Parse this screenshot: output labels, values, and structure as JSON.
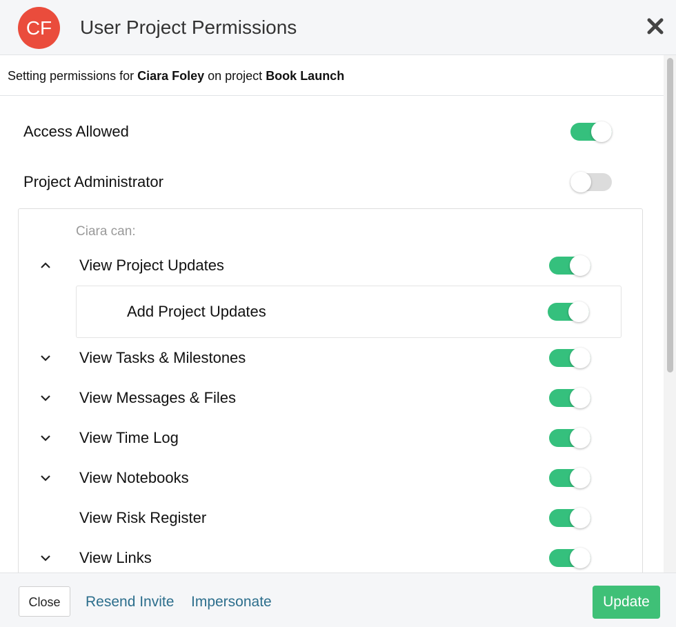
{
  "header": {
    "avatar_initials": "CF",
    "title": "User Project Permissions",
    "close_icon": "close-x-icon"
  },
  "subtitle": {
    "prefix": "Setting permissions for ",
    "user": "Ciara Foley",
    "middle": " on project ",
    "project": "Book Launch"
  },
  "top_permissions": [
    {
      "label": "Access Allowed",
      "enabled": true
    },
    {
      "label": "Project Administrator",
      "enabled": false
    }
  ],
  "permissions_heading": "Ciara can:",
  "permissions": [
    {
      "label": "View Project Updates",
      "enabled": true,
      "chevron": "up"
    },
    {
      "label": "Add Project Updates",
      "enabled": true,
      "chevron": "none",
      "sub": true
    },
    {
      "label": "View Tasks & Milestones",
      "enabled": true,
      "chevron": "down"
    },
    {
      "label": "View Messages & Files",
      "enabled": true,
      "chevron": "down"
    },
    {
      "label": "View Time Log",
      "enabled": true,
      "chevron": "down"
    },
    {
      "label": "View Notebooks",
      "enabled": true,
      "chevron": "down"
    },
    {
      "label": "View Risk Register",
      "enabled": true,
      "chevron": "none"
    },
    {
      "label": "View Links",
      "enabled": true,
      "chevron": "down"
    }
  ],
  "footer": {
    "close_label": "Close",
    "resend_label": "Resend Invite",
    "impersonate_label": "Impersonate",
    "update_label": "Update"
  },
  "colors": {
    "accent_green": "#35c07d",
    "avatar_red": "#ea4c3c",
    "link_blue": "#2c6e8c"
  }
}
